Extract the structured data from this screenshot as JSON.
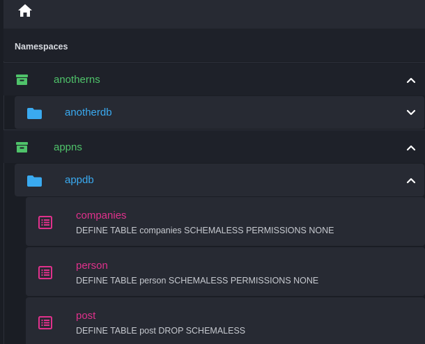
{
  "header": {
    "home_icon": "home-icon"
  },
  "sidebar": {
    "section_title": "Namespaces"
  },
  "namespaces": [
    {
      "name": "anotherns",
      "expanded": true,
      "databases": [
        {
          "name": "anotherdb",
          "expanded": false
        }
      ]
    },
    {
      "name": "appns",
      "expanded": true,
      "databases": [
        {
          "name": "appdb",
          "expanded": true,
          "tables": [
            {
              "name": "companies",
              "definition": "DEFINE TABLE companies SCHEMALESS PERMISSIONS NONE"
            },
            {
              "name": "person",
              "definition": "DEFINE TABLE person SCHEMALESS PERMISSIONS NONE"
            },
            {
              "name": "post",
              "definition": "DEFINE TABLE post DROP SCHEMALESS"
            }
          ]
        }
      ]
    }
  ],
  "colors": {
    "namespace": "#4fc36a",
    "database": "#3aaaf0",
    "table": "#e0318c",
    "background": "#1a1d24",
    "card": "#272a33"
  }
}
